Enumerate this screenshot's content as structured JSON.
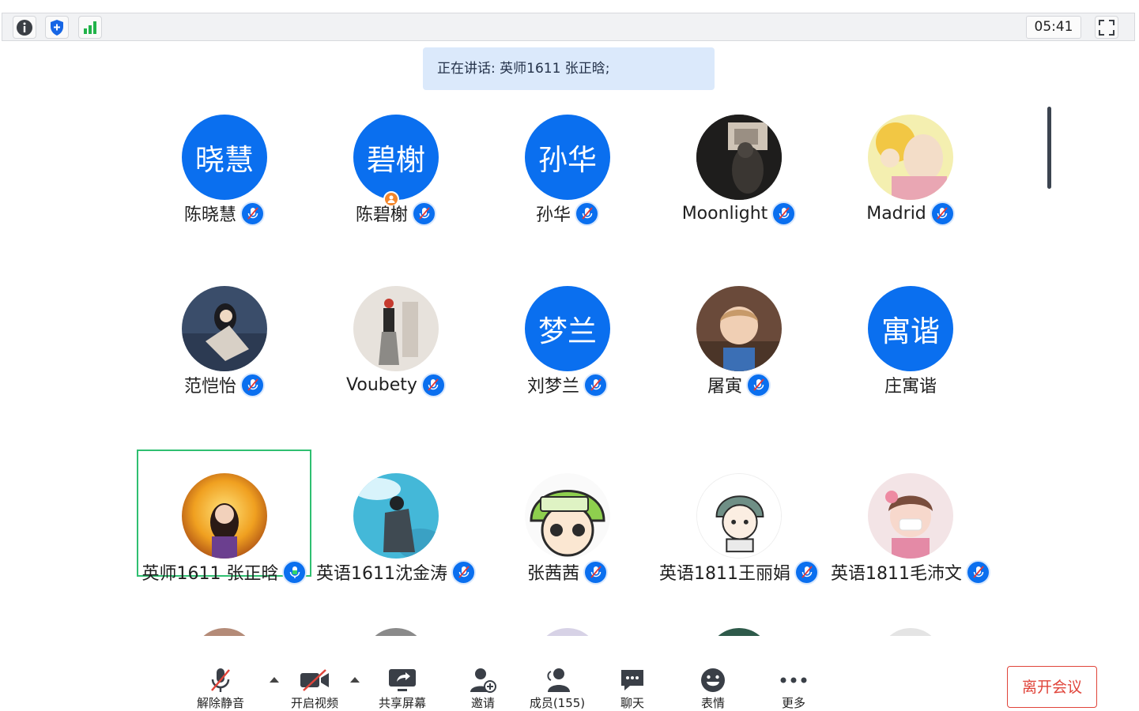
{
  "topbar": {
    "timer": "05:41",
    "icons": [
      "info-icon",
      "shield-icon",
      "signal-icon",
      "fullscreen-icon"
    ]
  },
  "speaking": {
    "text": "正在讲话: 英师1611 张正晗;"
  },
  "participants": [
    {
      "name": "陈晓慧",
      "avatar_text": "晓慧",
      "muted": true
    },
    {
      "name": "陈碧榭",
      "avatar_text": "碧榭",
      "muted": true,
      "host": true
    },
    {
      "name": "孙华",
      "avatar_text": "孙华",
      "muted": true
    },
    {
      "name": "Moonlight",
      "avatar_text": "",
      "muted": true
    },
    {
      "name": "Madrid",
      "avatar_text": "",
      "muted": true
    },
    {
      "name": "范恺怡",
      "avatar_text": "",
      "muted": true
    },
    {
      "name": "Voubety",
      "avatar_text": "",
      "muted": true
    },
    {
      "name": "刘梦兰",
      "avatar_text": "梦兰",
      "muted": true
    },
    {
      "name": "屠寅",
      "avatar_text": "",
      "muted": true
    },
    {
      "name": "庄寓谐",
      "avatar_text": "寓谐",
      "muted": false
    },
    {
      "name": "英师1611 张正晗",
      "avatar_text": "",
      "muted": false,
      "speaking": true
    },
    {
      "name": "英语1611沈金涛",
      "avatar_text": "",
      "muted": true
    },
    {
      "name": "张茜茜",
      "avatar_text": "",
      "muted": true
    },
    {
      "name": "英语1811王丽娟",
      "avatar_text": "",
      "muted": true
    },
    {
      "name": "英语1811毛沛文",
      "avatar_text": "",
      "muted": true
    }
  ],
  "toolbar": {
    "unmute": "解除静音",
    "video": "开启视频",
    "share": "共享屏幕",
    "invite": "邀请",
    "members": "成员(155)",
    "chat": "聊天",
    "emoji": "表情",
    "more": "更多",
    "leave": "离开会议"
  },
  "colors": {
    "accent": "#0a6fef",
    "speaking_bg": "#dbe9fb",
    "active_border": "#2fbf71",
    "leave": "#e0443a"
  }
}
